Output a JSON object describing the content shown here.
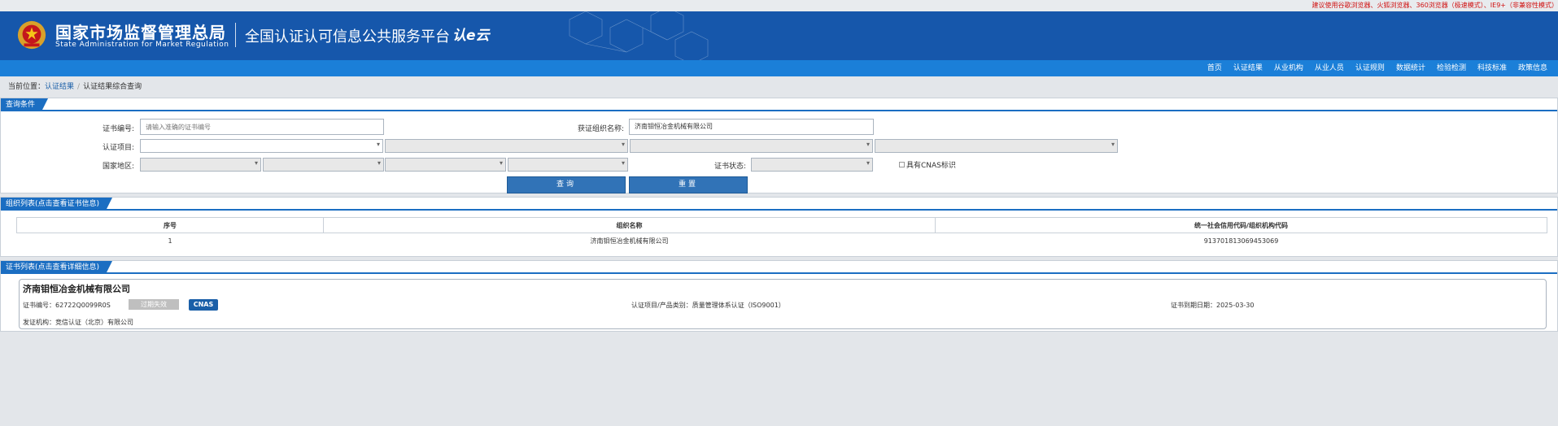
{
  "browser_tip": "建议使用谷歌浏览器、火狐浏览器、360浏览器（极速模式）、IE9+（非兼容性模式）",
  "header": {
    "agency_cn": "国家市场监督管理总局",
    "agency_en": "State Administration  for  Market Regulation",
    "platform": "全国认证认可信息公共服务平台",
    "logo_text": "认e云"
  },
  "nav": [
    "首页",
    "认证结果",
    "从业机构",
    "从业人员",
    "认证规则",
    "数据统计",
    "检验检测",
    "科技标准",
    "政策信息"
  ],
  "breadcrumb": {
    "prefix": "当前位置：",
    "link": "认证结果",
    "current": "认证结果综合查询"
  },
  "query": {
    "tab": "查询条件",
    "cert_no_label": "证书编号:",
    "cert_no_placeholder": "请输入准确的证书编号",
    "org_label": "获证组织名称:",
    "org_value": "济南钼恒冶金机械有限公司",
    "item_label": "认证项目:",
    "region_label": "国家地区:",
    "status_label": "证书状态:",
    "cnas_label": "具有CNAS标识",
    "search_btn": "查询",
    "reset_btn": "重置"
  },
  "org_list": {
    "tab": "组织列表(点击查看证书信息)",
    "headers": [
      "序号",
      "组织名称",
      "统一社会信用代码/组织机构代码"
    ],
    "rows": [
      [
        "1",
        "济南钼恒冶金机械有限公司",
        "91370181306945306​9"
      ]
    ]
  },
  "cert_list": {
    "tab": "证书列表(点击查看详细信息)",
    "items": [
      {
        "org_name": "济南钼恒冶金机械有限公司",
        "cert_no": "证书编号：62722Q0099R0S",
        "status": "过期失效",
        "cnas": "CNAS",
        "project": "认证项目/产品类别：质量管理体系认证（ISO9001）",
        "expiry": "证书到期日期：2025-03-30",
        "issuer": "发证机构：竞信认证（北京）有限公司"
      }
    ]
  }
}
